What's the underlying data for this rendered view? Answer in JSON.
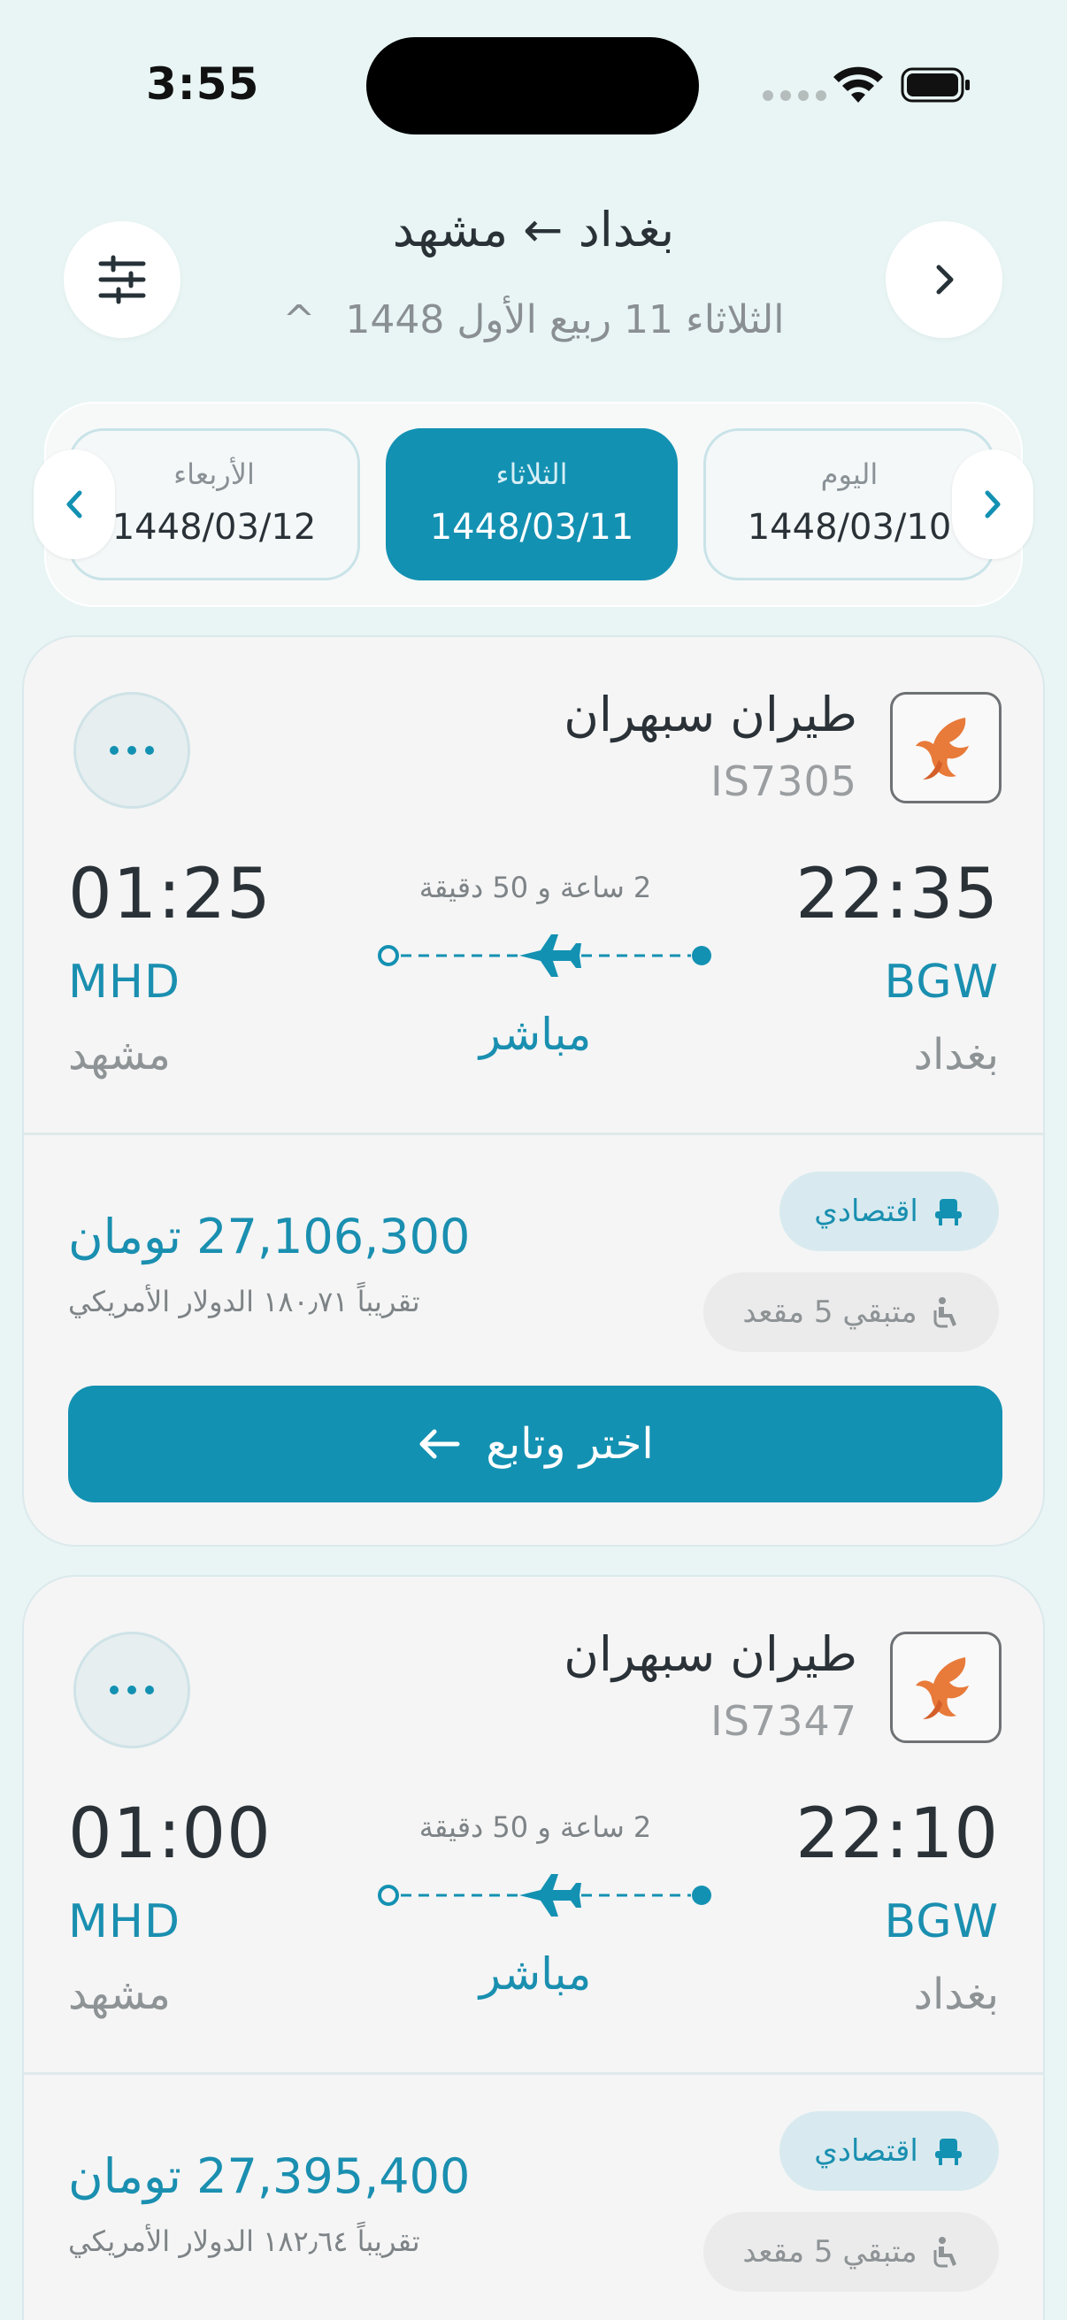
{
  "status_bar": {
    "time": "3:55"
  },
  "header": {
    "route": "بغداد ← مشهد",
    "date_line": "الثلاثاء 11 ربيع الأول 1448",
    "date_toggle": "^"
  },
  "date_strip": [
    {
      "day": "اليوم",
      "date": "1448/03/10",
      "active": false
    },
    {
      "day": "الثلاثاء",
      "date": "1448/03/11",
      "active": true
    },
    {
      "day": "الأربعاء",
      "date": "1448/03/12",
      "active": false
    }
  ],
  "flights": [
    {
      "airline": "طيران سبهران",
      "flight_no": "IS7305",
      "dep_time": "22:35",
      "arr_time": "01:25",
      "dep_iata": "BGW",
      "arr_iata": "MHD",
      "dep_city": "بغداد",
      "arr_city": "مشهد",
      "duration": "2 ساعة و 50 دقيقة",
      "stops": "مباشر",
      "price": "27,106,300 تومان",
      "usd": "تقريباً ١٨٠٫٧١ الدولار الأمريكي",
      "cabin": "اقتصادي",
      "seats": "متبقي 5 مقعد",
      "cta": "اختر وتابع"
    },
    {
      "airline": "طيران سبهران",
      "flight_no": "IS7347",
      "dep_time": "22:10",
      "arr_time": "01:00",
      "dep_iata": "BGW",
      "arr_iata": "MHD",
      "dep_city": "بغداد",
      "arr_city": "مشهد",
      "duration": "2 ساعة و 50 دقيقة",
      "stops": "مباشر",
      "price": "27,395,400 تومان",
      "usd": "تقريباً ١٨٢٫٦٤ الدولار الأمريكي",
      "cabin": "اقتصادي",
      "seats": "متبقي 5 مقعد"
    }
  ],
  "colors": {
    "accent": "#1391b2",
    "background": "#e8f5f4",
    "card": "#f5f5f5"
  }
}
